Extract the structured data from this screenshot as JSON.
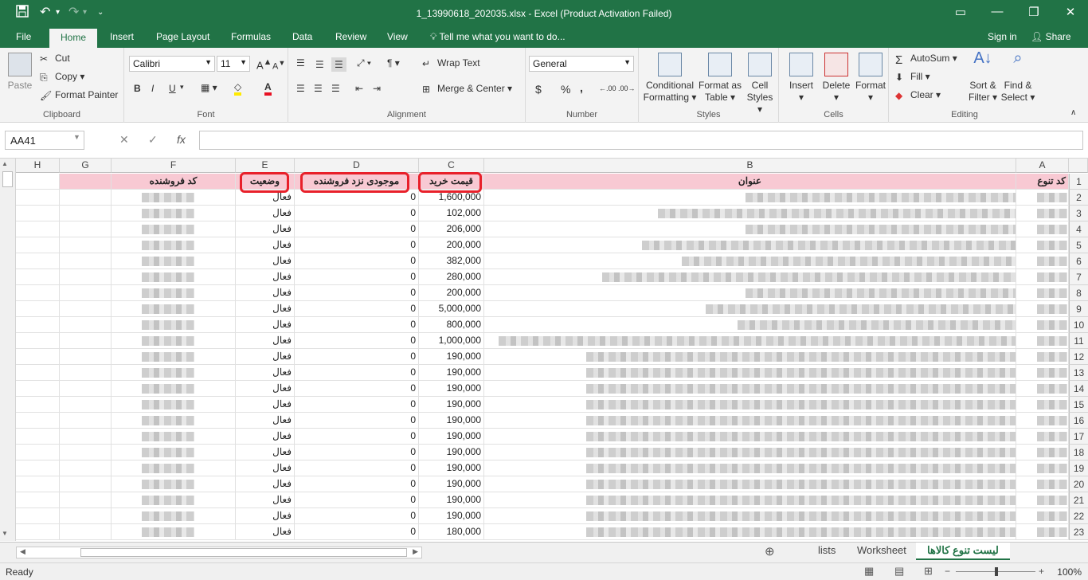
{
  "app": {
    "window_title": "1_13990618_202035.xlsx - Excel (Product Activation Failed)",
    "accent": "#217346",
    "header_fill": "#f8c9d3",
    "highlight": "#e8202a"
  },
  "quick_access": {
    "save_icon": "save-icon",
    "undo_icon": "undo-icon",
    "redo_icon": "redo-icon",
    "customize_icon": "customize-icon"
  },
  "window_controls": {
    "restore_ribbon": "▭",
    "minimize": "—",
    "maximize": "❐",
    "close": "✕"
  },
  "tabs": [
    "File",
    "Home",
    "Insert",
    "Page Layout",
    "Formulas",
    "Data",
    "Review",
    "View"
  ],
  "tell_me": "Tell me what you want to do...",
  "sign_in": "Sign in",
  "share": "Share",
  "ribbon": {
    "clipboard": {
      "paste": "Paste",
      "cut": "Cut",
      "copy": "Copy",
      "format_painter": "Format Painter",
      "label": "Clipboard"
    },
    "font": {
      "name": "Calibri",
      "size": "11",
      "bold": "B",
      "italic": "I",
      "underline": "U",
      "label": "Font"
    },
    "alignment": {
      "wrap": "Wrap Text",
      "merge": "Merge & Center",
      "label": "Alignment"
    },
    "number": {
      "format": "General",
      "currency": "$",
      "percent": "%",
      "comma": ",",
      "label": "Number"
    },
    "styles": {
      "conditional": "Conditional",
      "conditional2": "Formatting",
      "format_as": "Format as",
      "format_as2": "Table",
      "cell": "Cell",
      "cell2": "Styles",
      "label": "Styles"
    },
    "cells": {
      "insert": "Insert",
      "delete": "Delete",
      "format": "Format",
      "label": "Cells"
    },
    "editing": {
      "autosum": "AutoSum",
      "fill": "Fill",
      "clear": "Clear",
      "sort": "Sort &",
      "sort2": "Filter",
      "find": "Find &",
      "find2": "Select",
      "label": "Editing"
    }
  },
  "formula_bar": {
    "name_box": "AA41",
    "cancel": "✕",
    "enter": "✓",
    "fx": "fx",
    "value": ""
  },
  "columns": [
    "A",
    "B",
    "C",
    "D",
    "E",
    "F",
    "G",
    "H"
  ],
  "header_row": {
    "A": "کد تنوع",
    "B": "عنوان",
    "C": "قیمت خرید",
    "D": "موجودی نزد فروشنده",
    "E": "وضعیت",
    "F": "کد فروشنده"
  },
  "rows": [
    {
      "n": "2",
      "price": "1,600,000",
      "stock": "0",
      "status": "فعال"
    },
    {
      "n": "3",
      "price": "102,000",
      "stock": "0",
      "status": "فعال"
    },
    {
      "n": "4",
      "price": "206,000",
      "stock": "0",
      "status": "فعال"
    },
    {
      "n": "5",
      "price": "200,000",
      "stock": "0",
      "status": "فعال"
    },
    {
      "n": "6",
      "price": "382,000",
      "stock": "0",
      "status": "فعال"
    },
    {
      "n": "7",
      "price": "280,000",
      "stock": "0",
      "status": "فعال"
    },
    {
      "n": "8",
      "price": "200,000",
      "stock": "0",
      "status": "فعال"
    },
    {
      "n": "9",
      "price": "5,000,000",
      "stock": "0",
      "status": "فعال"
    },
    {
      "n": "10",
      "price": "800,000",
      "stock": "0",
      "status": "فعال"
    },
    {
      "n": "11",
      "price": "1,000,000",
      "stock": "0",
      "status": "فعال"
    },
    {
      "n": "12",
      "price": "190,000",
      "stock": "0",
      "status": "فعال"
    },
    {
      "n": "13",
      "price": "190,000",
      "stock": "0",
      "status": "فعال"
    },
    {
      "n": "14",
      "price": "190,000",
      "stock": "0",
      "status": "فعال"
    },
    {
      "n": "15",
      "price": "190,000",
      "stock": "0",
      "status": "فعال"
    },
    {
      "n": "16",
      "price": "190,000",
      "stock": "0",
      "status": "فعال"
    },
    {
      "n": "17",
      "price": "190,000",
      "stock": "0",
      "status": "فعال"
    },
    {
      "n": "18",
      "price": "190,000",
      "stock": "0",
      "status": "فعال"
    },
    {
      "n": "19",
      "price": "190,000",
      "stock": "0",
      "status": "فعال"
    },
    {
      "n": "20",
      "price": "190,000",
      "stock": "0",
      "status": "فعال"
    },
    {
      "n": "21",
      "price": "190,000",
      "stock": "0",
      "status": "فعال"
    },
    {
      "n": "22",
      "price": "190,000",
      "stock": "0",
      "status": "فعال"
    },
    {
      "n": "23",
      "price": "180,000",
      "stock": "0",
      "status": "فعال"
    }
  ],
  "sheets": [
    "lists",
    "Worksheet",
    "لیست تنوع کالاها"
  ],
  "status": {
    "ready": "Ready",
    "zoom": "100%"
  }
}
